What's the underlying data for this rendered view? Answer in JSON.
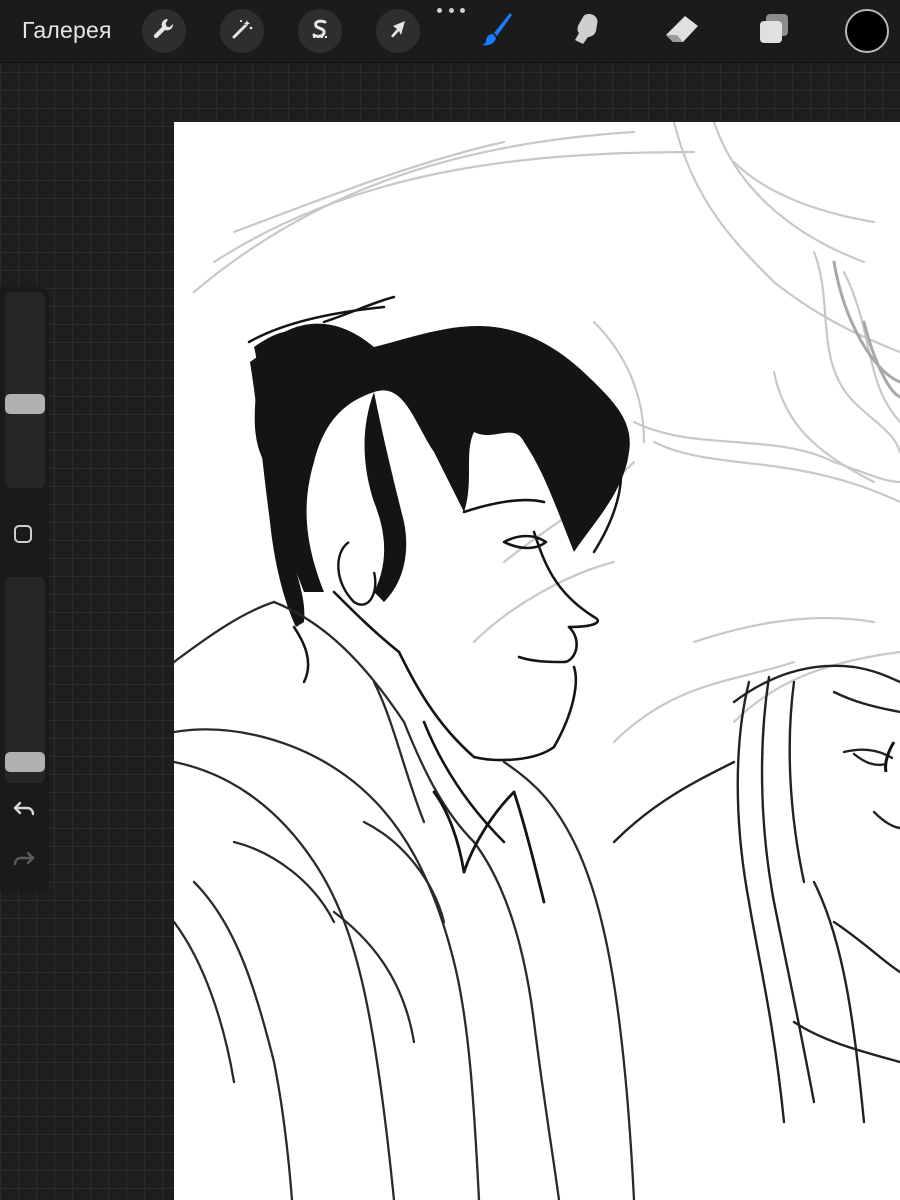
{
  "toolbar": {
    "gallery_label": "Галерея",
    "left_tools": [
      {
        "name": "wrench-icon",
        "role": "actions"
      },
      {
        "name": "magic-wand-icon",
        "role": "adjustments"
      },
      {
        "name": "selection-s-icon",
        "role": "selection"
      },
      {
        "name": "arrow-cursor-icon",
        "role": "transform"
      }
    ],
    "right_tools": [
      {
        "name": "brush-icon",
        "role": "paint",
        "active": true
      },
      {
        "name": "smudge-finger-icon",
        "role": "smudge"
      },
      {
        "name": "eraser-icon",
        "role": "erase"
      },
      {
        "name": "layers-icon",
        "role": "layers"
      }
    ],
    "current_color": "#000000",
    "active_tool_color": "#1a7dff"
  },
  "sidebar": {
    "brush_size_level": 0.58,
    "opacity_level": 0.94,
    "controls": [
      "modify-square-icon",
      "undo-icon",
      "redo-icon"
    ]
  },
  "colors": {
    "canvas": "#ffffff",
    "workspace": "#1e1e1f",
    "toolbar": "#1b1b1c",
    "sketch_light": "#bdbdbd",
    "ink": "#111111"
  }
}
